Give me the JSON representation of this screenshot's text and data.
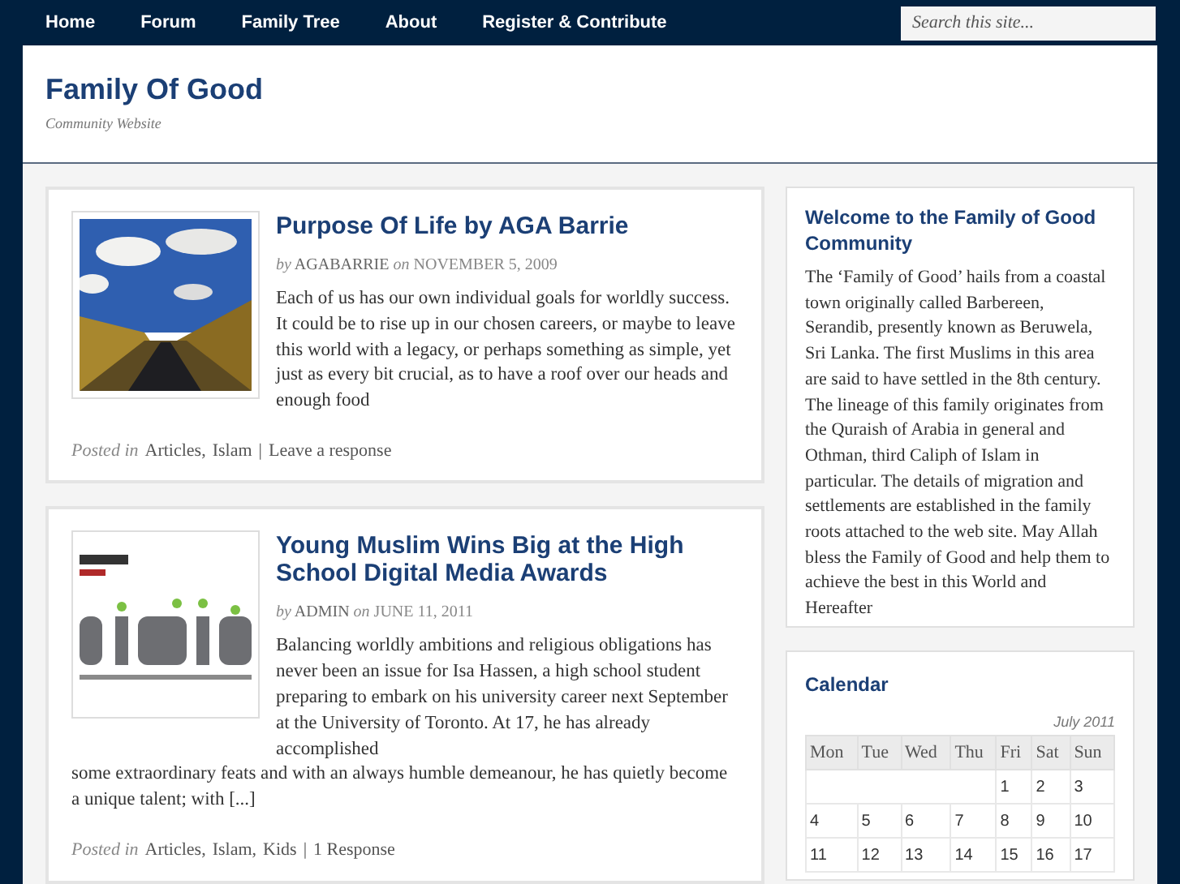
{
  "nav": {
    "items": [
      {
        "label": "Home"
      },
      {
        "label": "Forum"
      },
      {
        "label": "Family Tree"
      },
      {
        "label": "About"
      },
      {
        "label": "Register & Contribute"
      }
    ],
    "search": {
      "placeholder": "Search this site..."
    }
  },
  "header": {
    "title": "Family Of Good",
    "tagline": "Community Website"
  },
  "posts": [
    {
      "kind": "picture",
      "title": "Purpose Of Life by AGA Barrie",
      "by": "by",
      "author": "AGABARRIE",
      "on": "on",
      "date": "NOVEMBER 5, 2009",
      "excerpt": [
        "Each of us has our own individual goals for worldly success. It could be to rise up in our chosen careers, or maybe to leave this world with a legacy, or perhaps something as simple, yet just as every bit crucial, as to have a roof over our heads and enough food"
      ],
      "posted_in": "Posted in",
      "categories": [
        "Articles,",
        "Islam"
      ],
      "separator": "|",
      "responses": "Leave a response"
    },
    {
      "kind": "picture",
      "title": "Young Muslim Wins Big at the High School Digital Media Awards",
      "by": "by",
      "author": "ADMIN",
      "on": "on",
      "date": "JUNE 11, 2011",
      "excerpt": [
        "Balancing worldly ambitions and religious obligations has never been an issue for Isa Hassen, a high school student preparing to embark on his university career next September at the University of Toronto.  At 17, he has already accomplished",
        "some extraordinary feats and with an always humble demeanour, he has quietly become a unique talent; with [...]"
      ],
      "posted_in": "Posted in",
      "categories": [
        "Articles,",
        "Islam,",
        "Kids"
      ],
      "separator": "|",
      "responses": "1 Response"
    }
  ],
  "sidebar": {
    "welcome": {
      "title": "Welcome to the Family of Good Community",
      "text": "The ‘Family of Good’ hails from a coastal town originally called Barbereen, Serandib, presently known as Beruwela, Sri Lanka. The first Muslims in this area are said to have settled in the 8th century. The lineage of this family originates from the Quraish of Arabia in general and Othman, third Caliph of Islam in particular. The details of migration and settlements are established in the family roots attached to the web site. May Allah bless the Family of Good and help them to achieve the best in this World and Hereafter"
    },
    "calendar": {
      "title": "Calendar",
      "caption": "July 2011",
      "weekdays": [
        "Mon",
        "Tue",
        "Wed",
        "Thu",
        "Fri",
        "Sat",
        "Sun"
      ],
      "weeks": [
        [
          "1",
          "2",
          "3"
        ],
        [
          "4",
          "5",
          "6",
          "7",
          "8",
          "9",
          "10"
        ],
        [
          "11",
          "12",
          "13",
          "14",
          "15",
          "16",
          "17"
        ]
      ]
    }
  }
}
